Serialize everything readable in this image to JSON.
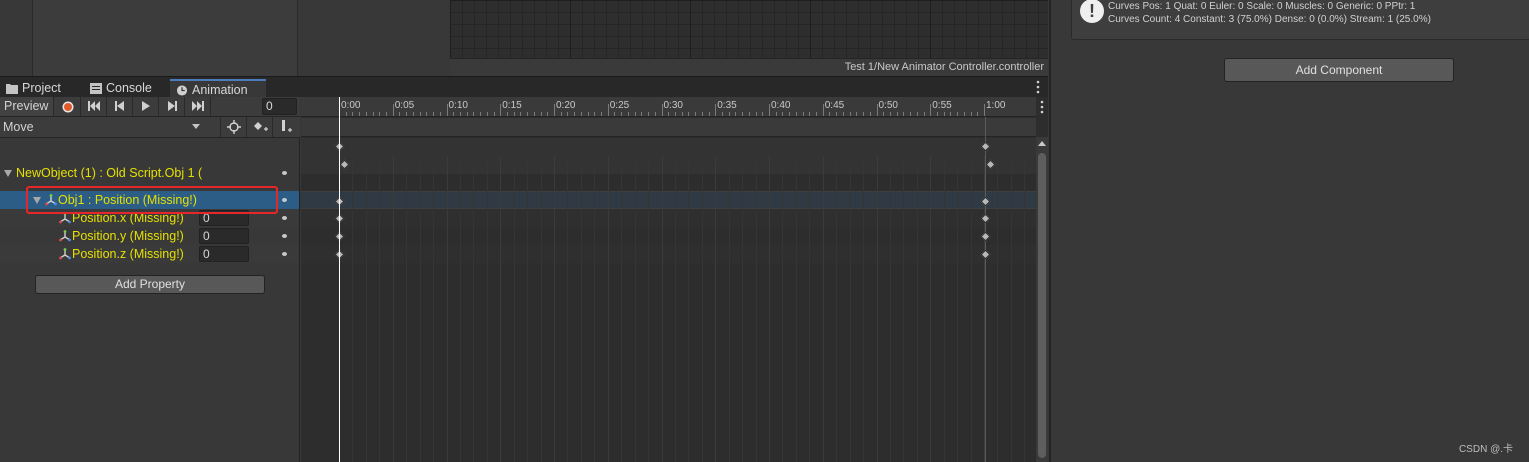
{
  "animator": {
    "path": "Test 1/New Animator Controller.controller"
  },
  "inspector": {
    "info_line_1": "Curves Pos: 1 Quat: 0 Euler: 0 Scale: 0 Muscles: 0 Generic: 0 PPtr: 1",
    "info_line_2": "Curves Count: 4 Constant: 3 (75.0%) Dense: 0 (0.0%) Stream: 1 (25.0%)",
    "add_component_label": "Add Component",
    "info_icon": "exclamation-icon"
  },
  "tabs": [
    {
      "label": "Project",
      "icon": "folder-icon"
    },
    {
      "label": "Console",
      "icon": "console-icon"
    },
    {
      "label": "Animation",
      "icon": "clock-icon",
      "active": true
    }
  ],
  "anim_toolbar": {
    "preview_label": "Preview",
    "frame_value": "0",
    "buttons": [
      "record-icon",
      "first-key-icon",
      "prev-key-icon",
      "play-icon",
      "next-key-icon",
      "last-key-icon"
    ]
  },
  "clip_toolbar": {
    "mode_label": "Move",
    "buttons": [
      "filter-icon",
      "add-keyframe-icon",
      "add-event-icon"
    ]
  },
  "properties": {
    "newobject_label": "NewObject (1) : Old Script.Obj 1 (",
    "obj1_label": "Obj1 : Position (Missing!)",
    "pos_x_label": "Position.x (Missing!)",
    "pos_x_value": "0",
    "pos_y_label": "Position.y (Missing!)",
    "pos_y_value": "0",
    "pos_z_label": "Position.z (Missing!)",
    "pos_z_value": "0",
    "add_property_label": "Add Property"
  },
  "timeline": {
    "ruler_labels": [
      "0:00",
      "0:05",
      "0:10",
      "0:15",
      "0:20",
      "0:25",
      "0:30",
      "0:35",
      "0:40",
      "0:45",
      "0:50",
      "0:55",
      "1:00"
    ]
  },
  "watermark": "CSDN @.卡",
  "colors": {
    "missing_text": "#e5e000",
    "selection": "#2c5d87",
    "highlight_box": "#e5262a",
    "record": "#e05a2a"
  }
}
